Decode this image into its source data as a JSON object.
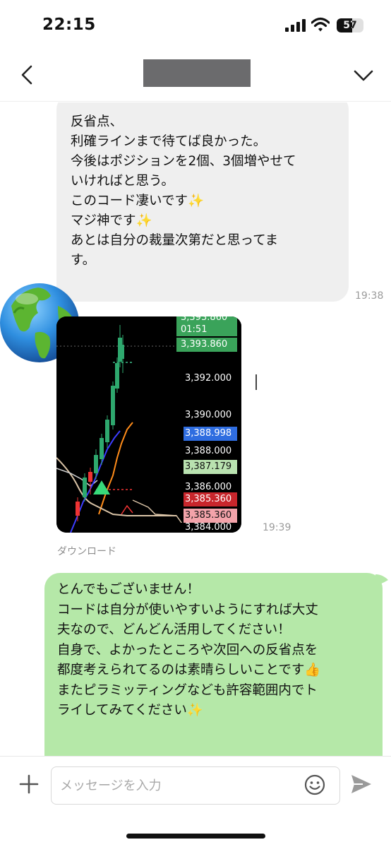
{
  "status_bar": {
    "time": "22:15",
    "battery_level": "57",
    "icons": [
      "signal-icon",
      "wifi-icon",
      "battery-icon"
    ]
  },
  "header": {
    "icons": [
      "chevron-left-icon",
      "chevron-down-icon"
    ]
  },
  "messages": {
    "incoming_text": {
      "lines": [
        "反省点、",
        "利確ラインまで待てば良かった。",
        "今後はポジションを2個、3個増やせて",
        "いければと思う。",
        "",
        "このコード凄いです",
        "マジ神です",
        "あとは自分の裁量次第だと思ってま",
        "す。"
      ],
      "emoji": "✨",
      "time": "19:38"
    },
    "incoming_image": {
      "time": "19:39",
      "download_label": "ダウンロード",
      "price_labels": [
        {
          "text": "3,393.860",
          "bg": "#3aa35a",
          "color": "#ffffff"
        },
        {
          "text": "01:51",
          "bg": "#3aa35a",
          "color": "#ffffff"
        },
        {
          "text": "3,393.860",
          "bg": "#3aa35a",
          "color": "#ffffff"
        },
        {
          "text": "3,392.000",
          "bg": "#000000",
          "color": "#ffffff"
        },
        {
          "text": "3,390.000",
          "bg": "#000000",
          "color": "#ffffff"
        },
        {
          "text": "3,388.998",
          "bg": "#2f6de0",
          "color": "#ffffff"
        },
        {
          "text": "3,388.000",
          "bg": "#000000",
          "color": "#ffffff"
        },
        {
          "text": "3,387.179",
          "bg": "#b9e2b0",
          "color": "#111111"
        },
        {
          "text": "3,386.000",
          "bg": "#000000",
          "color": "#ffffff"
        },
        {
          "text": "3,385.360",
          "bg": "#c8262c",
          "color": "#ffffff"
        },
        {
          "text": "3,385.360",
          "bg": "#f3a3aa",
          "color": "#111111"
        },
        {
          "text": "3,384.000",
          "bg": "#000000",
          "color": "#ffffff"
        }
      ]
    },
    "outgoing_text": {
      "lines": [
        "とんでもございません！",
        "コードは自分が使いやすいようにすれば大丈",
        "夫なので、どんどん活用してください！",
        "",
        "自身で、よかったところや次回への反省点を",
        "都度考えられてるのは素晴らしいことです",
        "",
        "またピラミッティングなども許容範囲内でト",
        "ライしてみてください"
      ],
      "emoji_thumb": "👍",
      "emoji_sparkle": "✨"
    }
  },
  "composer": {
    "placeholder": "メッセージを入力",
    "icons": [
      "plus-icon",
      "smile-icon",
      "send-icon"
    ]
  },
  "colors": {
    "incoming_bubble": "#efefef",
    "outgoing_bubble": "#b5e8a8",
    "timestamp": "#9b9b9b"
  }
}
